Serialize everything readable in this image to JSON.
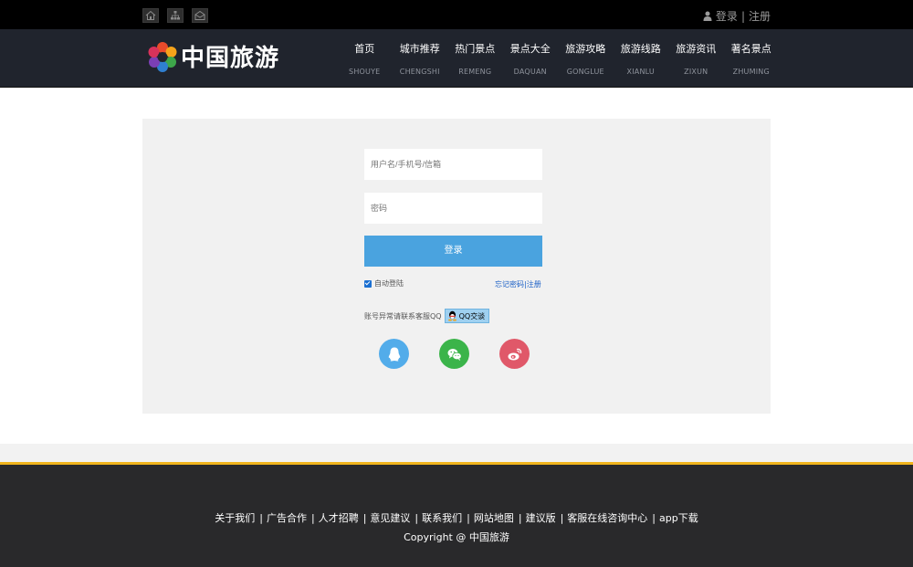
{
  "topbar": {
    "icons": [
      "home-icon",
      "sitemap-icon",
      "mail-icon"
    ],
    "login": "登录",
    "separator": "|",
    "register": "注册"
  },
  "header": {
    "logo_text": "中国旅游",
    "nav": [
      {
        "cn": "首页",
        "en": "SHOUYE"
      },
      {
        "cn": "城市推荐",
        "en": "CHENGSHI"
      },
      {
        "cn": "热门景点",
        "en": "REMENG"
      },
      {
        "cn": "景点大全",
        "en": "DAQUAN"
      },
      {
        "cn": "旅游攻略",
        "en": "GONGLUE"
      },
      {
        "cn": "旅游线路",
        "en": "XIANLU"
      },
      {
        "cn": "旅游资讯",
        "en": "ZIXUN"
      },
      {
        "cn": "著名景点",
        "en": "ZHUMING"
      }
    ]
  },
  "login_form": {
    "username_placeholder": "用户名/手机号/信箱",
    "password_placeholder": "密码",
    "submit_label": "登录",
    "remember_label": "自动登陆",
    "remember_checked": true,
    "forgot_register": "忘记密码|注册",
    "support_text": "账号异常请联系客服QQ",
    "qq_chat_label": "QQ交谈",
    "social": [
      "qq-icon",
      "wechat-icon",
      "weibo-icon"
    ]
  },
  "footer": {
    "links": [
      "关于我们",
      "广告合作",
      "人才招聘",
      "意见建议",
      "联系我们",
      "网站地图",
      "建议版",
      "客服在线咨询中心",
      "app下载"
    ],
    "separator": "|",
    "copyright": "Copyright @ 中国旅游"
  },
  "colors": {
    "topbar_bg": "#000000",
    "header_bg": "#20242d",
    "panel_bg": "#f1f1f1",
    "button_blue": "#4aa3df",
    "footer_bg": "#29292b",
    "footer_accent": "#f0b41d",
    "qq_blue": "#52acea",
    "wechat_green": "#3bb44a",
    "weibo_red": "#e05869"
  }
}
